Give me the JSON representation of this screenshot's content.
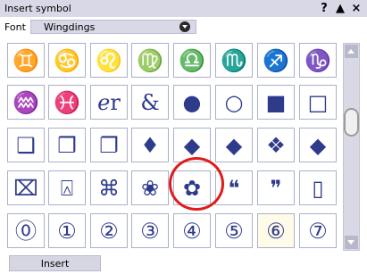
{
  "window": {
    "title": "Insert symbol",
    "help_label": "?",
    "minimize_label": "▲",
    "close_label": "×"
  },
  "font": {
    "label": "Font",
    "value": "Wingdings"
  },
  "symbols": [
    [
      "♊",
      "♋",
      "♌",
      "♍",
      "♎",
      "♏",
      "♐",
      "♑"
    ],
    [
      "♒",
      "♓",
      "ℯr",
      "&",
      "●",
      "○",
      "■",
      "□"
    ],
    [
      "❑",
      "❒",
      "❐",
      "♦",
      "◆",
      "◆",
      "❖",
      "◆"
    ],
    [
      "⌧",
      "⍓",
      "⌘",
      "❀",
      "✿",
      "❝",
      "❞",
      "▯"
    ],
    [
      "⓪",
      "①",
      "②",
      "③",
      "④",
      "⑤",
      "⑥",
      "⑦"
    ]
  ],
  "highlighted_cell": {
    "row": 4,
    "col": 6
  },
  "actions": {
    "insert_label": "Insert"
  },
  "colors": {
    "symbol": "#2e3b8b",
    "grid_border": "#a9b1cb",
    "annotation_ring": "#e01b1b"
  }
}
